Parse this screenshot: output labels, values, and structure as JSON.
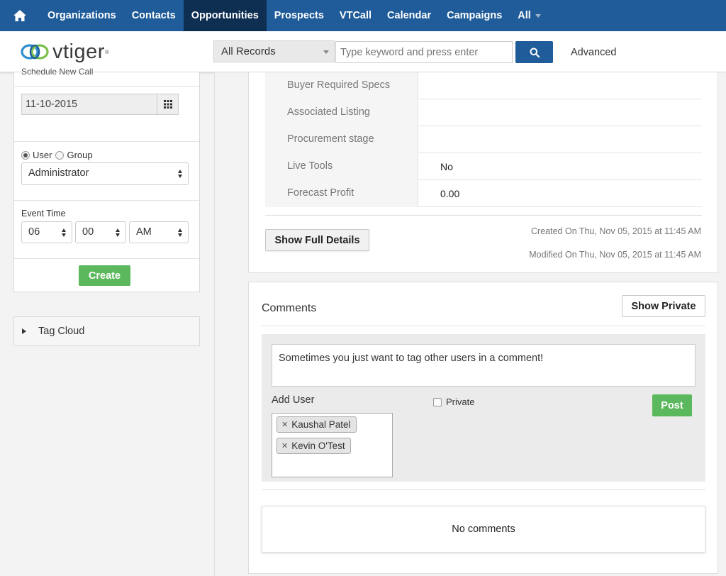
{
  "nav": {
    "items": [
      {
        "label": "Organizations"
      },
      {
        "label": "Contacts"
      },
      {
        "label": "Opportunities",
        "active": true
      },
      {
        "label": "Prospects"
      },
      {
        "label": "VTCall"
      },
      {
        "label": "Calendar"
      },
      {
        "label": "Campaigns"
      },
      {
        "label": "All"
      }
    ]
  },
  "header": {
    "logo_text": "vtiger",
    "records_select": "All Records",
    "search_placeholder": "Type keyword and press enter",
    "advanced_label": "Advanced"
  },
  "quick_event": {
    "schedule_label": "Schedule New Call",
    "date_value": "11-10-2015",
    "assign_user_label": "User",
    "assign_group_label": "Group",
    "assigned_to": "Administrator",
    "event_time_label": "Event Time",
    "hour": "06",
    "minute": "00",
    "ampm": "AM",
    "create_label": "Create"
  },
  "tag_cloud": {
    "label": "Tag Cloud"
  },
  "details": {
    "fields": [
      {
        "label": "Buyer Required Specs",
        "value": ""
      },
      {
        "label": "Associated Listing",
        "value": ""
      },
      {
        "label": "Procurement stage",
        "value": ""
      },
      {
        "label": "Live Tools",
        "value": "No"
      },
      {
        "label": "Forecast Profit",
        "value": "0.00"
      }
    ],
    "show_full_label": "Show Full Details",
    "created_on": "Created On Thu, Nov 05, 2015 at 11:45 AM",
    "modified_on": "Modified On Thu, Nov 05, 2015 at 11:45 AM"
  },
  "comments": {
    "title": "Comments",
    "show_private_label": "Show Private",
    "comment_text": "Sometimes you just want to tag other users in a comment!",
    "add_user_label": "Add User",
    "private_label": "Private",
    "post_label": "Post",
    "tagged_users": [
      "Kaushal Patel",
      "Kevin O'Test"
    ],
    "empty_text": "No comments"
  },
  "colors": {
    "nav_bg": "#1f5c99",
    "nav_active": "#0f2f52",
    "success": "#5cb85c"
  }
}
